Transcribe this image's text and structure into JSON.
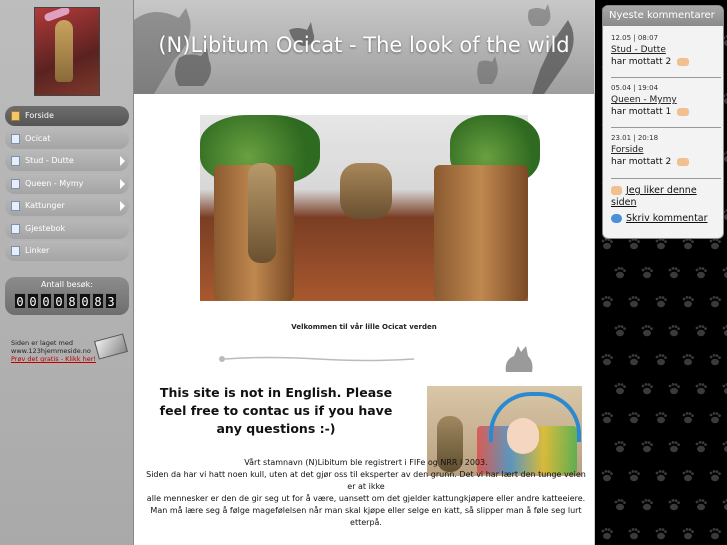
{
  "site_title": "(N)Libitum Ocicat - The look of the wild",
  "nav": {
    "items": [
      {
        "label": "Forside"
      },
      {
        "label": "Ocicat"
      },
      {
        "label": "Stud - Dutte"
      },
      {
        "label": "Queen - Mymy"
      },
      {
        "label": "Kattunger"
      },
      {
        "label": "Gjestebok"
      },
      {
        "label": "Linker"
      }
    ]
  },
  "counter": {
    "label": "Antall besøk:",
    "digits": [
      "0",
      "0",
      "0",
      "0",
      "8",
      "0",
      "8",
      "3"
    ]
  },
  "made_by": {
    "line1": "Siden er laget med",
    "line2": "www.123hjemmeside.no",
    "link": "Prøv det gratis - Klikk her!"
  },
  "content": {
    "welcome": "Velkommen til vår lille Ocicat verden",
    "intro_en": "This site is not in English. Please feel free to contac us if you have any questions :-)",
    "paragraphs": [
      "Vårt stamnavn (N)Libitum ble registrert i FIFe og NRR i 2003.",
      "Siden da har vi hatt noen kull, uten at det gjør oss til eksperter av den grunn. Det vi har lært den tunge veien er at ikke",
      "alle mennesker er den de gir seg ut for å være, uansett om det gjelder kattungkjøpere eller andre katteeiere. Man må lære seg å følge magefølelsen når man skal kjøpe eller selge en katt, så slipper man å føle seg lurt etterpå."
    ]
  },
  "comments_widget": {
    "title": "Nyeste kommentarer",
    "entries": [
      {
        "time": "12.05 | 08:07",
        "page": "Stud - Dutte",
        "text": "har mottatt 2"
      },
      {
        "time": "05.04 | 19:04",
        "page": "Queen - Mymy",
        "text": "har mottatt 1"
      },
      {
        "time": "23.01 | 20:18",
        "page": "Forside",
        "text": "har mottatt 2"
      }
    ],
    "like_label": "Jeg liker denne siden",
    "comment_label": "Skriv kommentar"
  }
}
